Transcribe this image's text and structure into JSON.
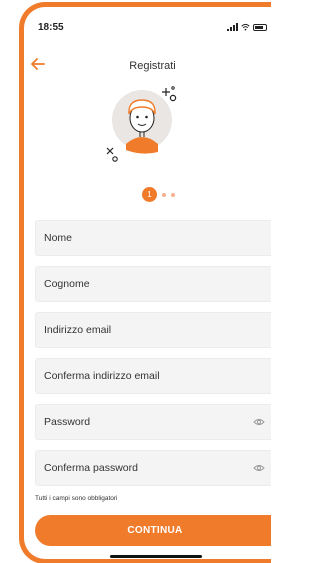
{
  "status_bar": {
    "time": "18:55"
  },
  "header": {
    "title": "Registrati",
    "back_icon": "arrow-left-icon"
  },
  "stepper": {
    "current_step": "1",
    "total_steps": 3
  },
  "form": {
    "fields": [
      {
        "label": "Nome"
      },
      {
        "label": "Cognome"
      },
      {
        "label": "Indirizzo email"
      },
      {
        "label": "Conferma indirizzo email"
      },
      {
        "label": "Password",
        "icon": "eye-icon"
      },
      {
        "label": "Conferma password",
        "icon": "eye-icon"
      }
    ],
    "hint": "Tutti i campi sono obbligatori"
  },
  "actions": {
    "continue_label": "CONTINUA"
  },
  "colors": {
    "accent": "#f07b2b",
    "field_bg": "#f4f4f4"
  }
}
